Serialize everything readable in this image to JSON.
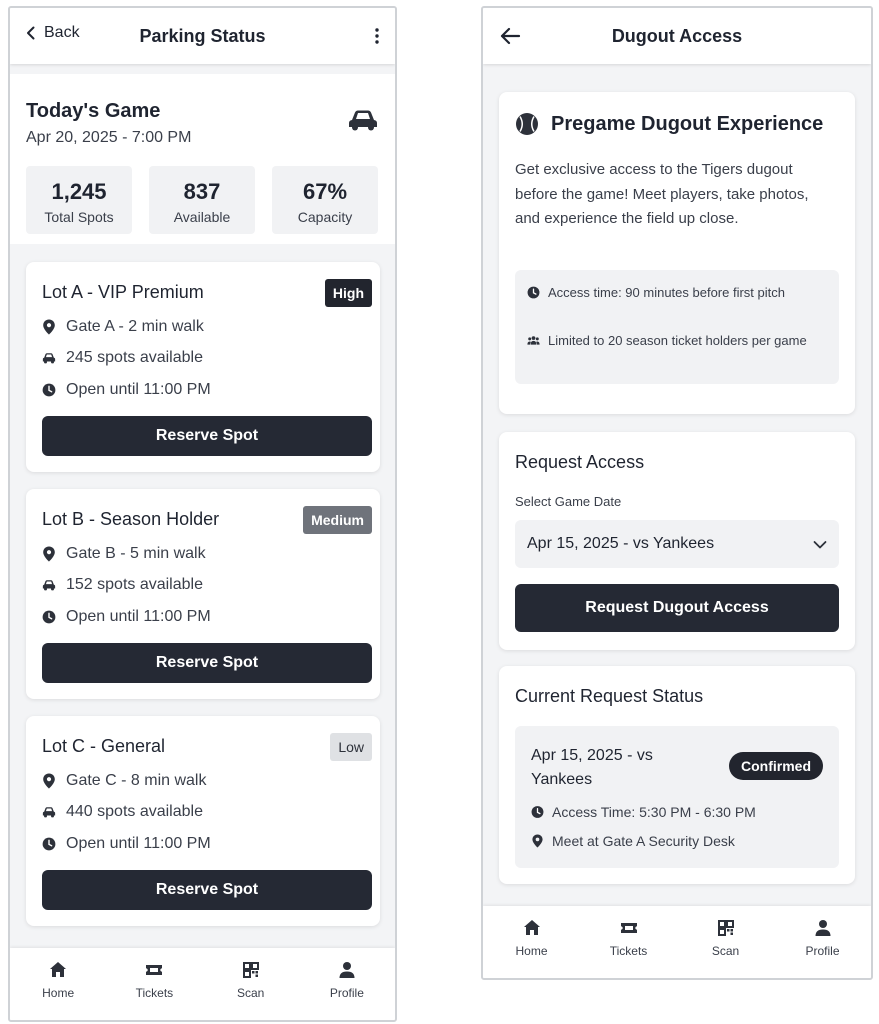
{
  "parking": {
    "back_label": "Back",
    "title": "Parking Status",
    "game": {
      "title": "Today's Game",
      "date": "Apr 20, 2025 - 7:00 PM"
    },
    "stats": [
      {
        "value": "1,245",
        "label": "Total Spots"
      },
      {
        "value": "837",
        "label": "Available"
      },
      {
        "value": "67%",
        "label": "Capacity"
      }
    ],
    "lots": [
      {
        "name": "Lot A - VIP Premium",
        "badge": "High",
        "gate": "Gate A - 2 min walk",
        "spots": "245 spots available",
        "hours": "Open until 11:00 PM",
        "button": "Reserve Spot"
      },
      {
        "name": "Lot B - Season Holder",
        "badge": "Medium",
        "gate": "Gate B - 5 min walk",
        "spots": "152 spots available",
        "hours": "Open until 11:00 PM",
        "button": "Reserve Spot"
      },
      {
        "name": "Lot C - General",
        "badge": "Low",
        "gate": "Gate C - 8 min walk",
        "spots": "440 spots available",
        "hours": "Open until 11:00 PM",
        "button": "Reserve Spot"
      }
    ],
    "nav": [
      "Home",
      "Tickets",
      "Scan",
      "Profile"
    ]
  },
  "dugout": {
    "title": "Dugout Access",
    "experience": {
      "title": "Pregame Dugout Experience",
      "description": "Get exclusive access to the Tigers dugout before the game! Meet players, take photos, and experience the field up close.",
      "access_time": "Access time: 90 minutes before first pitch",
      "limit": "Limited to 20 season ticket holders per game"
    },
    "request": {
      "title": "Request Access",
      "field_label": "Select Game Date",
      "selected": "Apr 15, 2025 - vs Yankees",
      "button": "Request Dugout Access"
    },
    "status": {
      "title": "Current Request Status",
      "game": "Apr 15, 2025 - vs Yankees",
      "badge": "Confirmed",
      "access_time": "Access Time: 5:30 PM - 6:30 PM",
      "meet": "Meet at Gate A Security Desk"
    },
    "nav": [
      "Home",
      "Tickets",
      "Scan",
      "Profile"
    ]
  },
  "colors": {
    "primary_dark": "#252934",
    "badge_high": "#22252e",
    "badge_medium": "#6f737b",
    "badge_low": "#dfe1e4",
    "surface_gray": "#f1f2f4"
  },
  "icons": [
    "chevron-left-icon",
    "more-vert-icon",
    "car-icon",
    "map-pin-icon",
    "clock-icon",
    "arrow-left-icon",
    "baseball-icon",
    "users-icon",
    "chevron-down-icon",
    "home-icon",
    "ticket-icon",
    "qr-icon",
    "person-icon"
  ]
}
